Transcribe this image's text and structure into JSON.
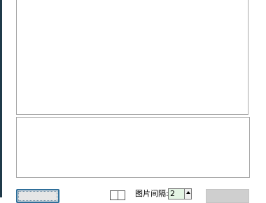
{
  "bottom_bar": {
    "spacing_label": "图片间隔:",
    "spacing_value": "2"
  }
}
